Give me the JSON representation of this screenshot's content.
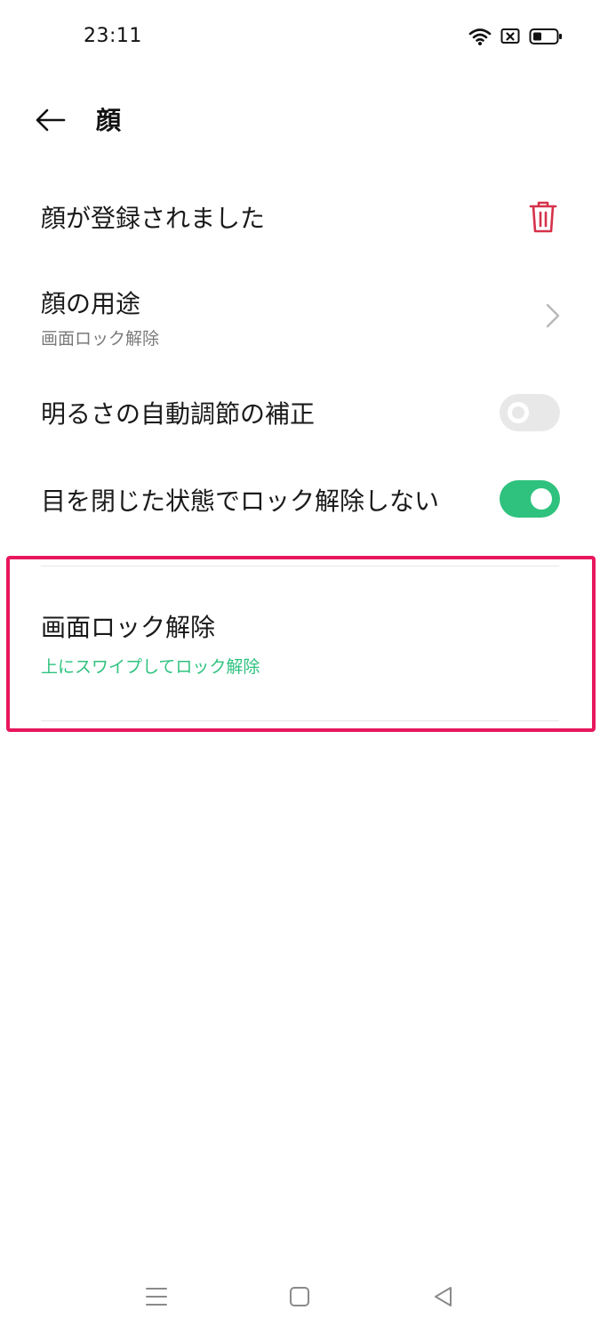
{
  "status_bar": {
    "time": "23:11",
    "icons": [
      "wifi-icon",
      "sim-blocked-icon",
      "battery-icon"
    ]
  },
  "app_bar": {
    "back_icon": "arrow-left-icon",
    "title": "顔"
  },
  "settings": {
    "face_registered": {
      "title": "顔が登録されました",
      "action_icon": "trash-icon",
      "action_color": "#d6324a"
    },
    "face_usage": {
      "title": "顔の用途",
      "subtitle": "画面ロック解除",
      "action_icon": "chevron-right-icon"
    },
    "brightness_correction": {
      "title": "明るさの自動調節の補正",
      "enabled": false
    },
    "eyes_closed": {
      "title": "目を閉じた状態でロック解除しない",
      "enabled": true,
      "accent": "#2ec27e"
    },
    "screen_unlock": {
      "title": "画面ロック解除",
      "subtitle": "上にスワイプしてロック解除",
      "subtitle_color": "#2ec27e"
    }
  },
  "highlight": {
    "color": "#e8175d"
  },
  "nav_bar": {
    "icons": [
      "menu-icon",
      "home-icon",
      "back-triangle-icon"
    ]
  }
}
